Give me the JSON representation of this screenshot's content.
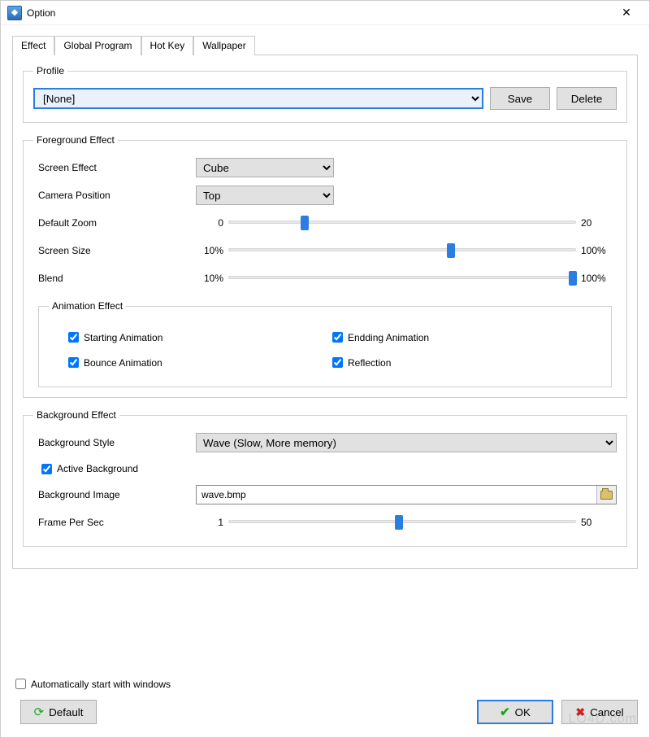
{
  "window": {
    "title": "Option"
  },
  "tabs": {
    "effect": "Effect",
    "global": "Global Program",
    "hotkey": "Hot Key",
    "wallpaper": "Wallpaper"
  },
  "profile": {
    "legend": "Profile",
    "value": "[None]",
    "save": "Save",
    "delete": "Delete"
  },
  "fg": {
    "legend": "Foreground Effect",
    "screen_effect_label": "Screen Effect",
    "screen_effect_value": "Cube",
    "camera_label": "Camera Position",
    "camera_value": "Top",
    "zoom_label": "Default Zoom",
    "zoom_min": "0",
    "zoom_max": "20",
    "size_label": "Screen Size",
    "size_min": "10%",
    "size_max": "100%",
    "blend_label": "Blend",
    "blend_min": "10%",
    "blend_max": "100%",
    "anim_legend": "Animation Effect",
    "anim_start": "Starting Animation",
    "anim_end": "Endding Animation",
    "anim_bounce": "Bounce Animation",
    "anim_reflection": "Reflection"
  },
  "bg": {
    "legend": "Background Effect",
    "style_label": "Background Style",
    "style_value": "Wave (Slow, More memory)",
    "active_label": "Active Background",
    "image_label": "Background Image",
    "image_value": "wave.bmp",
    "fps_label": "Frame Per Sec",
    "fps_min": "1",
    "fps_max": "50"
  },
  "footer": {
    "autostart": "Automatically start with windows",
    "default": "Default",
    "ok": "OK",
    "cancel": "Cancel"
  },
  "watermark": "LO4D.com"
}
